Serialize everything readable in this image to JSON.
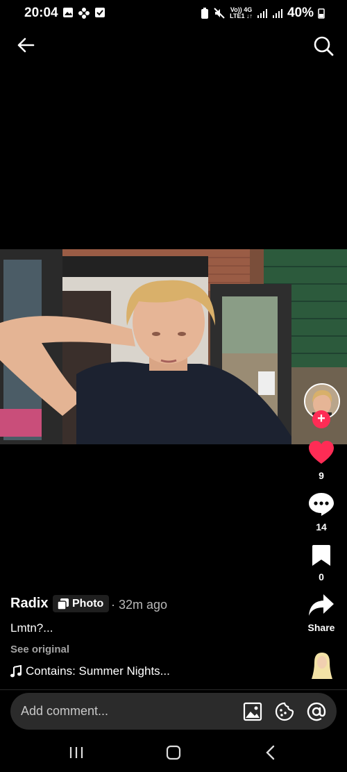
{
  "status_bar": {
    "time": "20:04",
    "net_top": "Vo)) 4G",
    "net_bottom": "LTE1 ↓↑",
    "battery": "40%"
  },
  "post": {
    "username": "Radix",
    "badge_label": "Photo",
    "time_ago": "· 32m ago",
    "caption": "Lmtn?...",
    "see_original": "See original",
    "music": "Contains: Summer Nights..."
  },
  "actions": {
    "likes": "9",
    "comments": "14",
    "saves": "0",
    "share_label": "Share",
    "like_color": "#fe2c55"
  },
  "comment_bar": {
    "placeholder": "Add comment..."
  },
  "icons": {
    "back": "back-arrow-icon",
    "search": "search-icon",
    "like": "heart-icon",
    "comment": "comment-bubble-icon",
    "save": "bookmark-icon",
    "share": "share-arrow-icon",
    "music": "music-note-icon",
    "image": "image-icon",
    "emoji": "emoji-icon",
    "mention": "at-sign-icon"
  }
}
